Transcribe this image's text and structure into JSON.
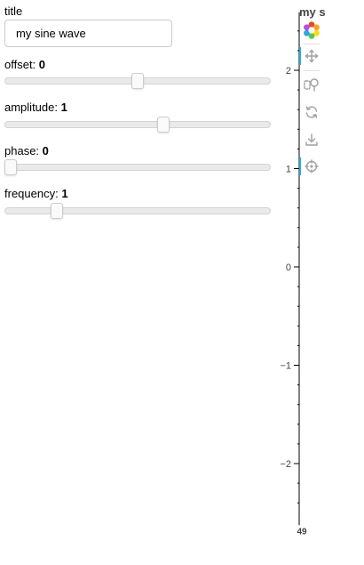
{
  "controls": {
    "title": {
      "label": "title",
      "value": "my sine wave"
    },
    "offset": {
      "label": "offset: ",
      "value": "0",
      "min": -5,
      "max": 5,
      "current": 0
    },
    "amplitude": {
      "label": "amplitude: ",
      "value": "1",
      "min": -5,
      "max": 5,
      "current": 1
    },
    "phase": {
      "label": "phase: ",
      "value": "0",
      "min": 0,
      "max": 6.2832,
      "current": 0
    },
    "frequency": {
      "label": "frequency: ",
      "value": "1",
      "min": 0.1,
      "max": 5.1,
      "current": 1
    }
  },
  "plot": {
    "title": "my s",
    "x_tick_label": "49",
    "y_ticks": [
      {
        "value": 2,
        "label": "2"
      },
      {
        "value": 1,
        "label": "1"
      },
      {
        "value": 0,
        "label": "0"
      },
      {
        "value": -1,
        "label": "−1"
      },
      {
        "value": -2,
        "label": "−2"
      }
    ],
    "y_range": [
      -2.5,
      2.5
    ],
    "toolbar": [
      {
        "name": "bokeh-logo-icon",
        "type": "logo"
      },
      {
        "name": "pan-tool-icon",
        "type": "pan",
        "active": true
      },
      {
        "name": "box-zoom-tool-icon",
        "type": "box-zoom"
      },
      {
        "name": "reset-tool-icon",
        "type": "reset"
      },
      {
        "name": "save-tool-icon",
        "type": "save"
      },
      {
        "name": "hover-tool-icon",
        "type": "hover",
        "active": true
      }
    ],
    "colors": {
      "axis": "#000000",
      "active": "#26aae1",
      "tool": "#a0a0a0"
    }
  }
}
